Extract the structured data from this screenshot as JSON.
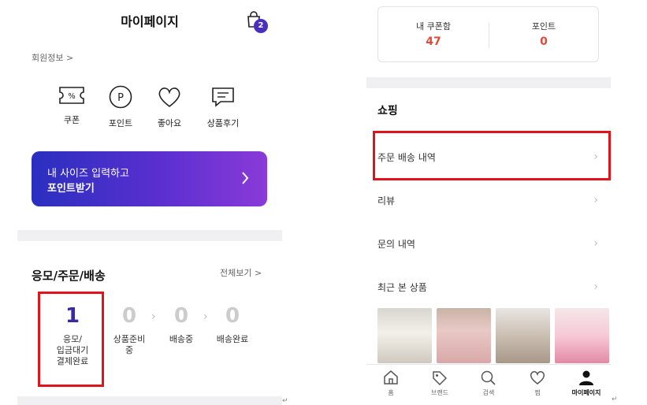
{
  "left": {
    "title": "마이페이지",
    "cart_badge": "2",
    "member_info": "회원정보 >",
    "quick_items": [
      {
        "label": "쿠폰",
        "icon": "coupon-icon"
      },
      {
        "label": "포인트",
        "icon": "point-icon"
      },
      {
        "label": "좋아요",
        "icon": "heart-icon"
      },
      {
        "label": "상품후기",
        "icon": "review-icon"
      }
    ],
    "banner": {
      "line1": "내 사이즈 입력하고",
      "line2": "포인트받기"
    },
    "orders": {
      "title": "응모/주문/배송",
      "see_all": "전체보기 >",
      "steps": [
        {
          "count": "1",
          "label_1": "응모/",
          "label_2": "입금대기",
          "label_3": "결제완료"
        },
        {
          "count": "0",
          "label_1": "상품준비",
          "label_2": "중",
          "label_3": ""
        },
        {
          "count": "0",
          "label_1": "배송중",
          "label_2": "",
          "label_3": ""
        },
        {
          "count": "0",
          "label_1": "배송완료",
          "label_2": "",
          "label_3": ""
        }
      ]
    }
  },
  "right": {
    "summary": [
      {
        "label": "내 쿠폰함",
        "value": "47"
      },
      {
        "label": "포인트",
        "value": "0"
      }
    ],
    "shopping_title": "쇼핑",
    "menu": [
      {
        "label": "주문 배송 내역"
      },
      {
        "label": "리뷰"
      },
      {
        "label": "문의 내역"
      },
      {
        "label": "최근 본 상품"
      }
    ],
    "tabs": [
      {
        "label": "홈",
        "icon": "home-icon"
      },
      {
        "label": "브랜드",
        "icon": "tag-icon"
      },
      {
        "label": "검색",
        "icon": "search-icon"
      },
      {
        "label": "찜",
        "icon": "heart-icon"
      },
      {
        "label": "마이페이지",
        "icon": "person-icon"
      }
    ]
  },
  "colors": {
    "accent": "#4a2fbf",
    "highlight": "#e0151b",
    "value_red": "#e04a3a"
  }
}
